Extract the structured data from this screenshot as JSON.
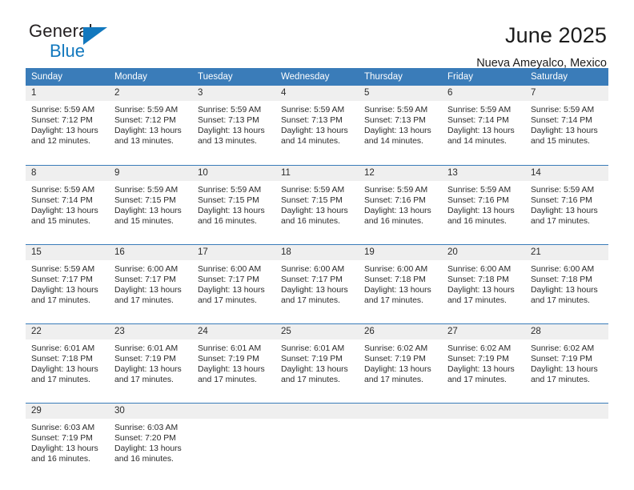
{
  "brand": {
    "name_part1": "General",
    "name_part2": "Blue",
    "logo_icon": "triangle-icon"
  },
  "header": {
    "title": "June 2025",
    "location": "Nueva Ameyalco, Mexico"
  },
  "calendar": {
    "weekdays": [
      "Sunday",
      "Monday",
      "Tuesday",
      "Wednesday",
      "Thursday",
      "Friday",
      "Saturday"
    ],
    "accent_color": "#3a7cb9",
    "daynum_bg": "#efefef",
    "weeks": [
      [
        {
          "day": "1",
          "sunrise": "Sunrise: 5:59 AM",
          "sunset": "Sunset: 7:12 PM",
          "daylight_line1": "Daylight: 13 hours",
          "daylight_line2": "and 12 minutes."
        },
        {
          "day": "2",
          "sunrise": "Sunrise: 5:59 AM",
          "sunset": "Sunset: 7:12 PM",
          "daylight_line1": "Daylight: 13 hours",
          "daylight_line2": "and 13 minutes."
        },
        {
          "day": "3",
          "sunrise": "Sunrise: 5:59 AM",
          "sunset": "Sunset: 7:13 PM",
          "daylight_line1": "Daylight: 13 hours",
          "daylight_line2": "and 13 minutes."
        },
        {
          "day": "4",
          "sunrise": "Sunrise: 5:59 AM",
          "sunset": "Sunset: 7:13 PM",
          "daylight_line1": "Daylight: 13 hours",
          "daylight_line2": "and 14 minutes."
        },
        {
          "day": "5",
          "sunrise": "Sunrise: 5:59 AM",
          "sunset": "Sunset: 7:13 PM",
          "daylight_line1": "Daylight: 13 hours",
          "daylight_line2": "and 14 minutes."
        },
        {
          "day": "6",
          "sunrise": "Sunrise: 5:59 AM",
          "sunset": "Sunset: 7:14 PM",
          "daylight_line1": "Daylight: 13 hours",
          "daylight_line2": "and 14 minutes."
        },
        {
          "day": "7",
          "sunrise": "Sunrise: 5:59 AM",
          "sunset": "Sunset: 7:14 PM",
          "daylight_line1": "Daylight: 13 hours",
          "daylight_line2": "and 15 minutes."
        }
      ],
      [
        {
          "day": "8",
          "sunrise": "Sunrise: 5:59 AM",
          "sunset": "Sunset: 7:14 PM",
          "daylight_line1": "Daylight: 13 hours",
          "daylight_line2": "and 15 minutes."
        },
        {
          "day": "9",
          "sunrise": "Sunrise: 5:59 AM",
          "sunset": "Sunset: 7:15 PM",
          "daylight_line1": "Daylight: 13 hours",
          "daylight_line2": "and 15 minutes."
        },
        {
          "day": "10",
          "sunrise": "Sunrise: 5:59 AM",
          "sunset": "Sunset: 7:15 PM",
          "daylight_line1": "Daylight: 13 hours",
          "daylight_line2": "and 16 minutes."
        },
        {
          "day": "11",
          "sunrise": "Sunrise: 5:59 AM",
          "sunset": "Sunset: 7:15 PM",
          "daylight_line1": "Daylight: 13 hours",
          "daylight_line2": "and 16 minutes."
        },
        {
          "day": "12",
          "sunrise": "Sunrise: 5:59 AM",
          "sunset": "Sunset: 7:16 PM",
          "daylight_line1": "Daylight: 13 hours",
          "daylight_line2": "and 16 minutes."
        },
        {
          "day": "13",
          "sunrise": "Sunrise: 5:59 AM",
          "sunset": "Sunset: 7:16 PM",
          "daylight_line1": "Daylight: 13 hours",
          "daylight_line2": "and 16 minutes."
        },
        {
          "day": "14",
          "sunrise": "Sunrise: 5:59 AM",
          "sunset": "Sunset: 7:16 PM",
          "daylight_line1": "Daylight: 13 hours",
          "daylight_line2": "and 17 minutes."
        }
      ],
      [
        {
          "day": "15",
          "sunrise": "Sunrise: 5:59 AM",
          "sunset": "Sunset: 7:17 PM",
          "daylight_line1": "Daylight: 13 hours",
          "daylight_line2": "and 17 minutes."
        },
        {
          "day": "16",
          "sunrise": "Sunrise: 6:00 AM",
          "sunset": "Sunset: 7:17 PM",
          "daylight_line1": "Daylight: 13 hours",
          "daylight_line2": "and 17 minutes."
        },
        {
          "day": "17",
          "sunrise": "Sunrise: 6:00 AM",
          "sunset": "Sunset: 7:17 PM",
          "daylight_line1": "Daylight: 13 hours",
          "daylight_line2": "and 17 minutes."
        },
        {
          "day": "18",
          "sunrise": "Sunrise: 6:00 AM",
          "sunset": "Sunset: 7:17 PM",
          "daylight_line1": "Daylight: 13 hours",
          "daylight_line2": "and 17 minutes."
        },
        {
          "day": "19",
          "sunrise": "Sunrise: 6:00 AM",
          "sunset": "Sunset: 7:18 PM",
          "daylight_line1": "Daylight: 13 hours",
          "daylight_line2": "and 17 minutes."
        },
        {
          "day": "20",
          "sunrise": "Sunrise: 6:00 AM",
          "sunset": "Sunset: 7:18 PM",
          "daylight_line1": "Daylight: 13 hours",
          "daylight_line2": "and 17 minutes."
        },
        {
          "day": "21",
          "sunrise": "Sunrise: 6:00 AM",
          "sunset": "Sunset: 7:18 PM",
          "daylight_line1": "Daylight: 13 hours",
          "daylight_line2": "and 17 minutes."
        }
      ],
      [
        {
          "day": "22",
          "sunrise": "Sunrise: 6:01 AM",
          "sunset": "Sunset: 7:18 PM",
          "daylight_line1": "Daylight: 13 hours",
          "daylight_line2": "and 17 minutes."
        },
        {
          "day": "23",
          "sunrise": "Sunrise: 6:01 AM",
          "sunset": "Sunset: 7:19 PM",
          "daylight_line1": "Daylight: 13 hours",
          "daylight_line2": "and 17 minutes."
        },
        {
          "day": "24",
          "sunrise": "Sunrise: 6:01 AM",
          "sunset": "Sunset: 7:19 PM",
          "daylight_line1": "Daylight: 13 hours",
          "daylight_line2": "and 17 minutes."
        },
        {
          "day": "25",
          "sunrise": "Sunrise: 6:01 AM",
          "sunset": "Sunset: 7:19 PM",
          "daylight_line1": "Daylight: 13 hours",
          "daylight_line2": "and 17 minutes."
        },
        {
          "day": "26",
          "sunrise": "Sunrise: 6:02 AM",
          "sunset": "Sunset: 7:19 PM",
          "daylight_line1": "Daylight: 13 hours",
          "daylight_line2": "and 17 minutes."
        },
        {
          "day": "27",
          "sunrise": "Sunrise: 6:02 AM",
          "sunset": "Sunset: 7:19 PM",
          "daylight_line1": "Daylight: 13 hours",
          "daylight_line2": "and 17 minutes."
        },
        {
          "day": "28",
          "sunrise": "Sunrise: 6:02 AM",
          "sunset": "Sunset: 7:19 PM",
          "daylight_line1": "Daylight: 13 hours",
          "daylight_line2": "and 17 minutes."
        }
      ],
      [
        {
          "day": "29",
          "sunrise": "Sunrise: 6:03 AM",
          "sunset": "Sunset: 7:19 PM",
          "daylight_line1": "Daylight: 13 hours",
          "daylight_line2": "and 16 minutes."
        },
        {
          "day": "30",
          "sunrise": "Sunrise: 6:03 AM",
          "sunset": "Sunset: 7:20 PM",
          "daylight_line1": "Daylight: 13 hours",
          "daylight_line2": "and 16 minutes."
        },
        {
          "day": "",
          "sunrise": "",
          "sunset": "",
          "daylight_line1": "",
          "daylight_line2": ""
        },
        {
          "day": "",
          "sunrise": "",
          "sunset": "",
          "daylight_line1": "",
          "daylight_line2": ""
        },
        {
          "day": "",
          "sunrise": "",
          "sunset": "",
          "daylight_line1": "",
          "daylight_line2": ""
        },
        {
          "day": "",
          "sunrise": "",
          "sunset": "",
          "daylight_line1": "",
          "daylight_line2": ""
        },
        {
          "day": "",
          "sunrise": "",
          "sunset": "",
          "daylight_line1": "",
          "daylight_line2": ""
        }
      ]
    ]
  }
}
